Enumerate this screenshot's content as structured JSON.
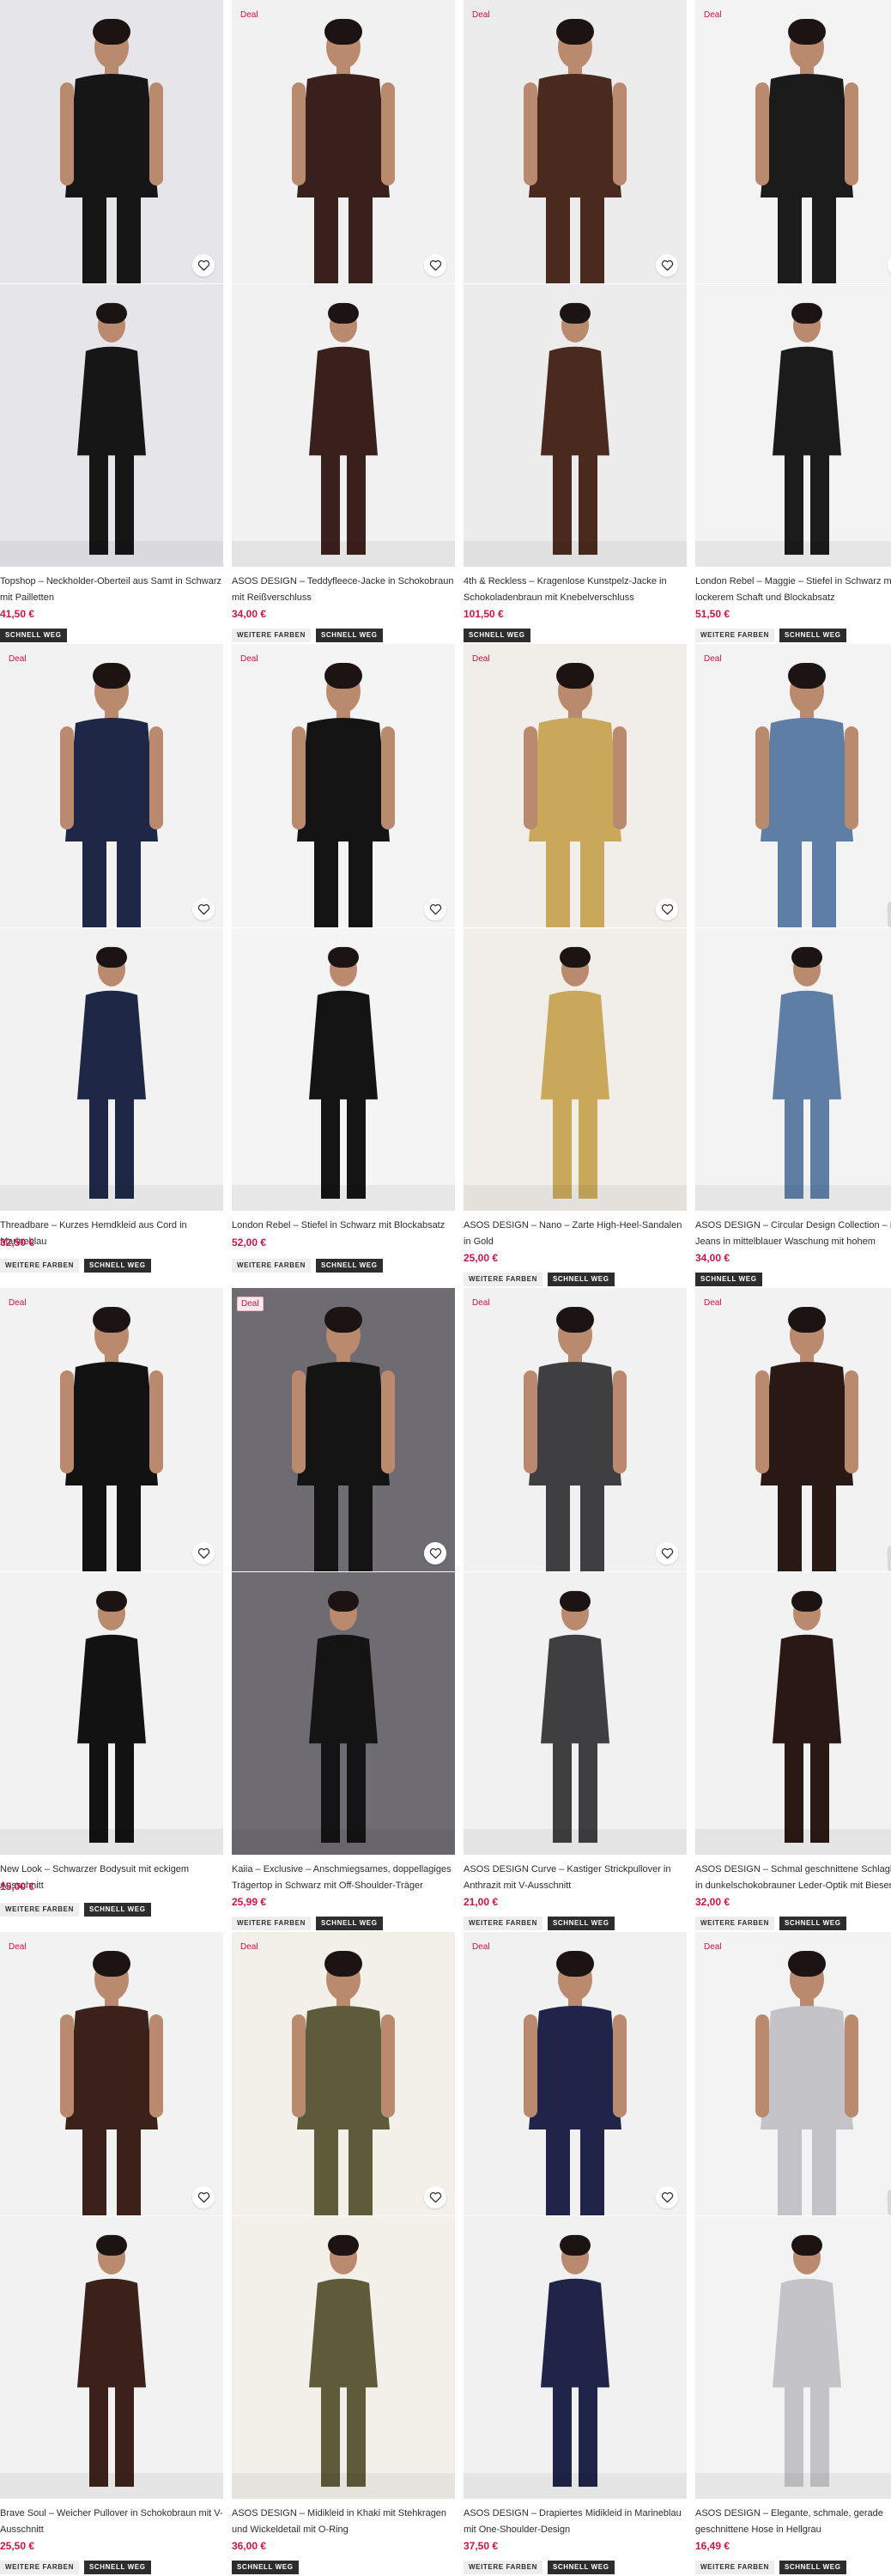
{
  "labels": {
    "deal": "Deal",
    "more_colors": "WEITERE FARBEN",
    "fast": "SCHNELL WEG"
  },
  "colors": {
    "price": "#d01345",
    "badge_fast_bg": "#2d2d2d",
    "badge_more_bg": "#eeeeee"
  },
  "products": [
    {
      "title": "Topshop – Neckholder-Oberteil aus Samt in Schwarz mit Pailletten",
      "price": "41,50 €",
      "deal": false,
      "more_colors": false,
      "fast": true,
      "image_top": "black-sequin-top-model",
      "image_bottom": "black-sequin-top-full-length",
      "bg": "#e6e6ea",
      "garment": "#161616"
    },
    {
      "title": "ASOS DESIGN – Teddyfleece-Jacke in Schokobraun mit Reißverschluss",
      "price": "34,00 €",
      "deal": true,
      "more_colors": true,
      "fast": true,
      "image_top": "brown-fleece-jacket-model",
      "image_bottom": "brown-fleece-jacket-full-length",
      "bg": "#f1f1f1",
      "garment": "#3a201c"
    },
    {
      "title": "4th & Reckless – Kragenlose Kunstpelz-Jacke in Schokoladenbraun mit Knebelverschluss",
      "price": "101,50 €",
      "deal": true,
      "more_colors": false,
      "fast": true,
      "image_top": "brown-faux-fur-jacket-model",
      "image_bottom": "faux-fur-toggle-closeup",
      "bg": "#ececec",
      "garment": "#4a2a1e"
    },
    {
      "title": "London Rebel – Maggie – Stiefel in Schwarz mit lockerem Schaft und Blockabsatz",
      "price": "51,50 €",
      "deal": true,
      "more_colors": true,
      "fast": true,
      "image_top": "black-slouch-boots-worn",
      "image_bottom": "black-slouch-boots-closeup",
      "bg": "#f3f3f3",
      "garment": "#1b1b1b"
    },
    {
      "title": "Threadbare – Kurzes Hemdkleid aus Cord in Marineblau",
      "price": "32,50 €",
      "deal": true,
      "more_colors": true,
      "fast": true,
      "image_top": "navy-cord-shirt-dress-model",
      "image_bottom": "navy-cord-shirt-dress-with-boots",
      "bg": "#f2f2f2",
      "garment": "#1e2746"
    },
    {
      "title": "London Rebel – Stiefel in Schwarz mit Blockabsatz",
      "price": "52,00 €",
      "deal": true,
      "more_colors": true,
      "fast": true,
      "image_top": "black-block-heel-boots-worn",
      "image_bottom": "black-block-heel-boot-side",
      "bg": "#f4f4f4",
      "garment": "#141414"
    },
    {
      "title": "ASOS DESIGN – Nano – Zarte High-Heel-Sandalen in Gold",
      "price": "25,00 €",
      "deal": true,
      "more_colors": true,
      "fast": true,
      "image_top": "gold-heeled-sandals-worn",
      "image_bottom": "gold-sandal-ankle-strap-closeup",
      "bg": "#f1ede8",
      "garment": "#c9a85c"
    },
    {
      "title": "ASOS DESIGN – Circular Design Collection – Barrel-Jeans in mittelblauer Waschung mit hohem",
      "price": "34,00 €",
      "deal": true,
      "more_colors": false,
      "fast": true,
      "image_top": "barrel-jeans-model",
      "image_bottom": "barrel-jeans-back-view",
      "bg": "#f3f3f3",
      "garment": "#5f7ea6"
    },
    {
      "title": "New Look – Schwarzer Bodysuit mit eckigem Ausschnitt",
      "price": "15,00 €",
      "deal": true,
      "more_colors": true,
      "fast": true,
      "image_top": "black-square-neck-bodysuit-model",
      "image_bottom": "black-bodysuit-back-view",
      "bg": "#f2f2f2",
      "garment": "#121212"
    },
    {
      "title": "Kaiia – Exclusive – Anschmiegsames, doppellagiges Trägertop in Schwarz mit Off-Shoulder-Träger",
      "price": "25,99 €",
      "deal": true,
      "more_colors": true,
      "fast": true,
      "image_top": "black-off-shoulder-top-model",
      "image_bottom": "black-off-shoulder-top-closeup",
      "bg": "#6f6b72",
      "garment": "#141414"
    },
    {
      "title": "ASOS DESIGN Curve – Kastiger Strickpullover in Anthrazit mit V-Ausschnitt",
      "price": "21,00 €",
      "deal": true,
      "more_colors": true,
      "fast": true,
      "image_top": "charcoal-v-neck-jumper-model",
      "image_bottom": "charcoal-jumper-full-length",
      "bg": "#f1f1f1",
      "garment": "#3f3f42"
    },
    {
      "title": "ASOS DESIGN – Schmal geschnittene Schlaghose in dunkelschokobrauner Leder-Optik mit Bieser",
      "price": "32,00 €",
      "deal": true,
      "more_colors": true,
      "fast": true,
      "image_top": "brown-leather-look-flares-model",
      "image_bottom": "brown-leather-look-flares-closeup",
      "bg": "#f2f2f2",
      "garment": "#2a1814"
    },
    {
      "title": "Brave Soul – Weicher Pullover in Schokobraun mit V-Ausschnitt",
      "price": "25,50 €",
      "deal": true,
      "more_colors": true,
      "fast": true,
      "image_top": "chocolate-v-neck-jumper-model",
      "image_bottom": "chocolate-jumper-closeup",
      "bg": "#f2f2f2",
      "garment": "#3b211a"
    },
    {
      "title": "ASOS DESIGN – Midikleid in Khaki mit Stehkragen und Wickeldetail mit O-Ring",
      "price": "36,00 €",
      "deal": true,
      "more_colors": false,
      "fast": true,
      "image_top": "khaki-midi-dress-model",
      "image_bottom": "khaki-dress-o-ring-closeup",
      "bg": "#f3f0ea",
      "garment": "#5e5b3a"
    },
    {
      "title": "ASOS DESIGN – Drapiertes Midikleid in Marineblau mit One-Shoulder-Design",
      "price": "37,50 €",
      "deal": true,
      "more_colors": true,
      "fast": true,
      "image_top": "navy-one-shoulder-midi-dress-model",
      "image_bottom": "navy-draped-dress-closeup",
      "bg": "#f1f1f1",
      "garment": "#1f2448"
    },
    {
      "title": "ASOS DESIGN – Elegante, schmale, gerade geschnittene Hose in Hellgrau",
      "price": "16,49 €",
      "deal": true,
      "more_colors": true,
      "fast": true,
      "image_top": "light-grey-trousers-model",
      "image_bottom": "light-grey-trousers-closeup",
      "bg": "#f3f3f3",
      "garment": "#c4c4c8"
    }
  ]
}
